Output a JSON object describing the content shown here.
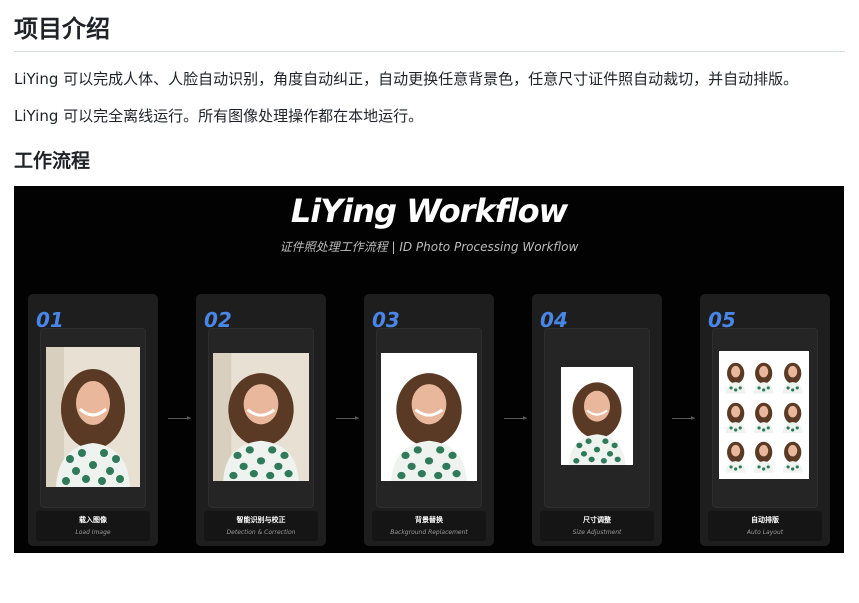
{
  "sections": {
    "intro_heading": "项目介绍",
    "intro_p1": "LiYing 可以完成人体、人脸自动识别，角度自动纠正，自动更换任意背景色，任意尺寸证件照自动裁切，并自动排版。",
    "intro_p2": "LiYing 可以完全离线运行。所有图像处理操作都在本地运行。",
    "workflow_heading": "工作流程"
  },
  "banner": {
    "title": "LiYing Workflow",
    "subtitle": "证件照处理工作流程 | ID Photo Processing Workflow",
    "steps": [
      {
        "num": "01",
        "zh": "载入图像",
        "en": "Load Image"
      },
      {
        "num": "02",
        "zh": "智能识别与校正",
        "en": "Detection & Correction"
      },
      {
        "num": "03",
        "zh": "背景替换",
        "en": "Background Replacement"
      },
      {
        "num": "04",
        "zh": "尺寸调整",
        "en": "Size Adjustment"
      },
      {
        "num": "05",
        "zh": "自动排版",
        "en": "Auto Layout"
      }
    ]
  }
}
